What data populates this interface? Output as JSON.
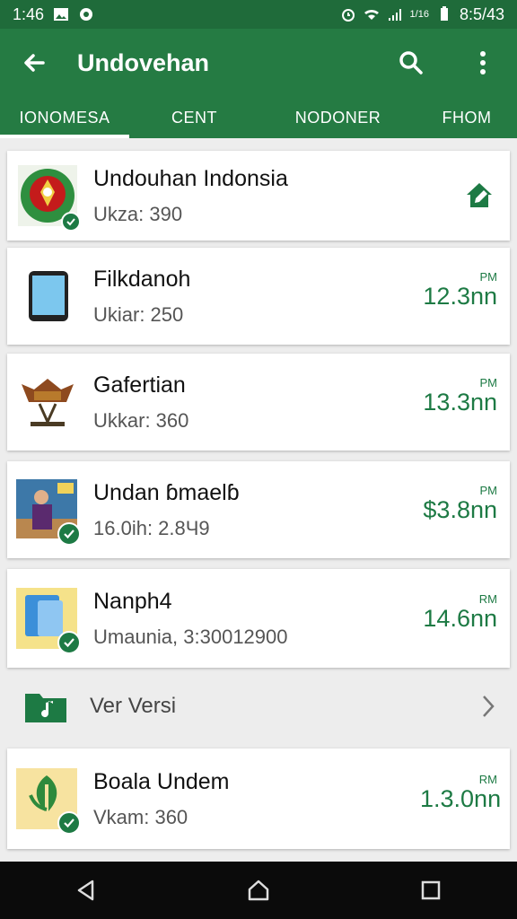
{
  "status_bar": {
    "time": "1:46",
    "right_text": "8:5/43",
    "signal_text": "1/16"
  },
  "app_bar": {
    "title": "Undovehan"
  },
  "tabs": [
    "IONOMESA",
    "CENT",
    "NODONER",
    "FHOM"
  ],
  "items": [
    {
      "name": "Undouhan Indonsia",
      "subtitle": "Ukza: 390",
      "pm": "",
      "value": ""
    },
    {
      "name": "Filkdanoh",
      "subtitle": "Ukiar: 250",
      "pm": "PM",
      "value": "12.3nn"
    },
    {
      "name": "Gafertian",
      "subtitle": "Ukkar: 360",
      "pm": "PM",
      "value": "13.3nn"
    },
    {
      "name": "Undan ɓmaelɓ",
      "subtitle": "16.0ih: 2.8Ч9",
      "pm": "PM",
      "value": "$3.8nn"
    },
    {
      "name": "Nanph4",
      "subtitle": "Umaunia, 3:30012900",
      "pm": "RM",
      "value": "14.6nn"
    },
    {
      "name": "Boala Undem",
      "subtitle": "Vkam: 360",
      "pm": "RM",
      "value": "1.3.0nn"
    }
  ],
  "versi": {
    "label": "Ver Versi"
  },
  "colors": {
    "primary": "#257b43",
    "status": "#1f6b3a",
    "accent": "#1d7a44"
  }
}
